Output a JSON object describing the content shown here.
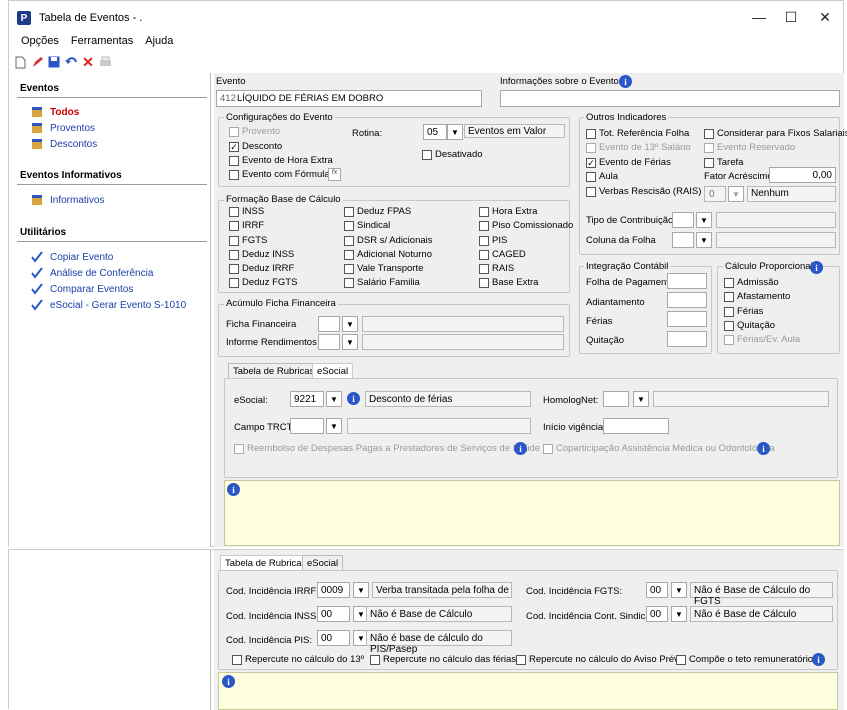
{
  "window": {
    "title": "Tabela de Eventos - ."
  },
  "menu": [
    "Opções",
    "Ferramentas",
    "Ajuda"
  ],
  "sidebar": {
    "eventos_header": "Eventos",
    "eventos": [
      "Todos",
      "Proventos",
      "Descontos"
    ],
    "informativos_header": "Eventos Informativos",
    "informativos": [
      "Informativos"
    ],
    "utilitarios_header": "Utilitários",
    "utilitarios": [
      "Copiar Evento",
      "Análise de Conferência",
      "Comparar Eventos",
      "eSocial - Gerar Evento S-1010"
    ]
  },
  "evento": {
    "label": "Evento",
    "code": "412",
    "name": "LÍQUIDO DE FÉRIAS EM DOBRO",
    "info_label": "Informações sobre o Evento"
  },
  "config": {
    "title": "Configurações do Evento",
    "provento": "Provento",
    "desconto": "Desconto",
    "hora_extra": "Evento de Hora Extra",
    "formula": "Evento com Fórmula",
    "rotina_label": "Rotina:",
    "rotina_code": "05",
    "rotina_value": "Eventos em Valor",
    "desativado": "Desativado",
    "fx": "fx"
  },
  "base": {
    "title": "Formação Base de Cálculo",
    "col1": [
      "INSS",
      "IRRF",
      "FGTS",
      "Deduz INSS",
      "Deduz IRRF",
      "Deduz FGTS"
    ],
    "col2": [
      "Deduz FPAS",
      "Sindical",
      "DSR s/ Adicionais",
      "Adicional Noturno",
      "Vale Transporte",
      "Salário Familia"
    ],
    "col3": [
      "Hora Extra",
      "Piso Comissionado",
      "PIS",
      "CAGED",
      "RAIS",
      "Base Extra"
    ]
  },
  "acumulo": {
    "title": "Acúmulo Ficha Financeira",
    "ficha": "Ficha Financeira",
    "informe": "Informe Rendimentos"
  },
  "outros": {
    "title": "Outros Indicadores",
    "tot_ref": "Tot. Referência Folha",
    "evento_13": "Evento de 13º Salário",
    "ferias": "Evento de Férias",
    "aula": "Aula",
    "verbas": "Verbas Rescisão (RAIS)",
    "fixos": "Considerar para Fixos Salariais",
    "reservado": "Evento Reservado",
    "tarefa": "Tarefa",
    "fator_label": "Fator Acréscimo",
    "fator_value": "0,00",
    "verbas_code": "0",
    "verbas_value": "Nenhum",
    "tipo_contrib": "Tipo de Contribuição",
    "coluna_folha": "Coluna da Folha"
  },
  "integracao": {
    "title": "Integração Contábil",
    "items": [
      "Folha de Pagamento",
      "Adiantamento",
      "Férias",
      "Quitação"
    ]
  },
  "calculo": {
    "title": "Cálculo Proporcional",
    "items": [
      "Admissão",
      "Afastamento",
      "Férias",
      "Quitação",
      "Férias/Ev. Aula"
    ]
  },
  "tabs1": {
    "tab_a": "Tabela de Rubricas",
    "tab_b": "eSocial"
  },
  "rubricas": {
    "esocial_label": "eSocial:",
    "esocial_code": "9221",
    "esocial_value": "Desconto de férias",
    "homolognet": "HomologNet:",
    "trct": "Campo TRCT:",
    "inicio": "Início vigência:",
    "reembolso": "Reembolso de Despesas Pagas a Prestadores de Serviços de Saúde",
    "copart": "Coparticipação Assistência Médica ou Odontológica"
  },
  "esocial": {
    "irrf_label": "Cod. Incidência IRRF:",
    "irrf_code": "0009",
    "irrf_value": "Verba transitada pela folha de paga",
    "inss_label": "Cod. Incidência INSS:",
    "inss_code": "00",
    "inss_value": "Não é Base de Cálculo",
    "pis_label": "Cod. Incidência PIS:",
    "pis_code": "00",
    "pis_value": "Não é base de cálculo do PIS/Pasep",
    "fgts_label": "Cod. Incidência FGTS:",
    "fgts_code": "00",
    "fgts_value": "Não é Base de Cálculo do FGTS",
    "sind_label": "Cod. Incidência Cont. Sindical:",
    "sind_code": "00",
    "sind_value": "Não é Base de Cálculo",
    "rep13": "Repercute no cálculo do 13º",
    "repferias": "Repercute no cálculo das férias",
    "repaviso": "Repercute no cálculo do Aviso Prévio",
    "teto": "Compõe o teto remuneratório"
  },
  "icons": {
    "app": "app-logo-icon",
    "info": "info-icon",
    "dropdown": "chevron-down-icon"
  }
}
